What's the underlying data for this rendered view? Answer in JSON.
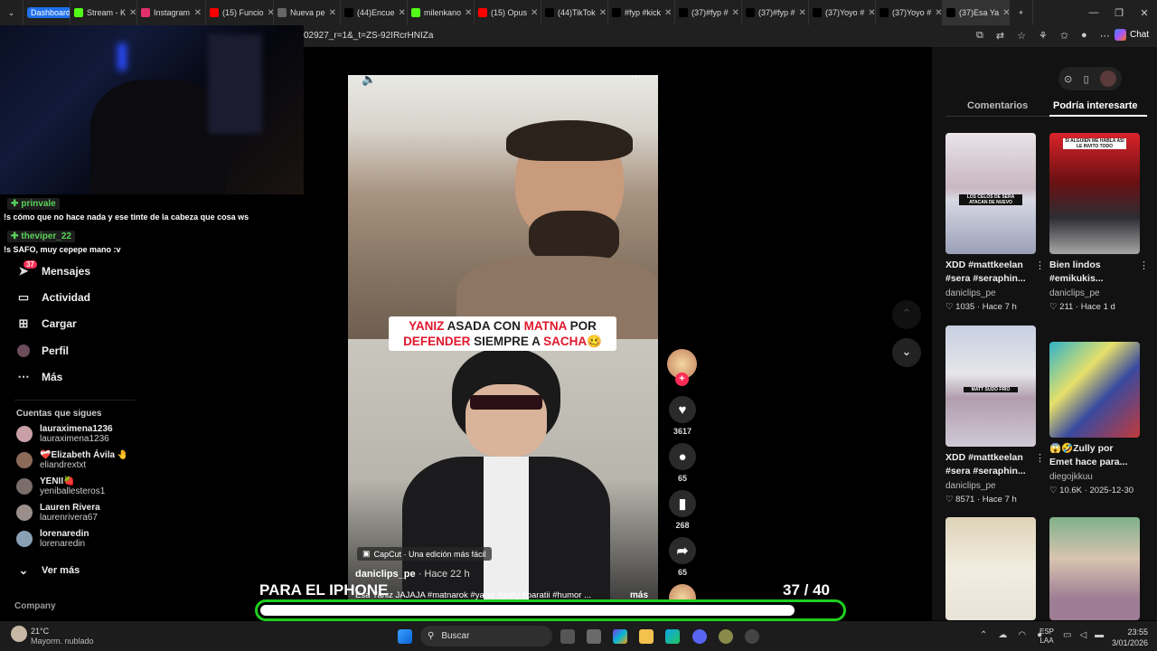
{
  "browser": {
    "tabs": [
      {
        "label": "Dashboard",
        "color": "#1f6feb"
      },
      {
        "label": "Stream - K",
        "color": "#53fc18"
      },
      {
        "label": "Instagram",
        "color": "#e1306c"
      },
      {
        "label": "(15) Funcio",
        "color": "#ff0000"
      },
      {
        "label": "Nueva pe",
        "color": "#666666"
      },
      {
        "label": "(44)Encue",
        "color": "#000000"
      },
      {
        "label": "milenkano",
        "color": "#53fc18"
      },
      {
        "label": "(15) Opus",
        "color": "#ff0000"
      },
      {
        "label": "(44)TikTok",
        "color": "#000000"
      },
      {
        "label": "#fyp #kick",
        "color": "#000000"
      },
      {
        "label": "(37)#fyp #",
        "color": "#000000"
      },
      {
        "label": "(37)#fyp #",
        "color": "#000000"
      },
      {
        "label": "(37)Yoyo #",
        "color": "#000000"
      },
      {
        "label": "(37)Yoyo #",
        "color": "#000000"
      },
      {
        "label": "(37)Esa Ya",
        "color": "#000000"
      }
    ],
    "url": "02927_r=1&_t=ZS-92IRcrHNIZa",
    "chat_label": "Chat"
  },
  "chat_overlay": [
    {
      "user": "prinvale",
      "msg": "!s cómo que no hace nada y ese tinte de la cabeza que cosa ws"
    },
    {
      "user": "theviper_22",
      "msg": "!s SAFO, muy cepepe mano :v"
    }
  ],
  "sidebar": {
    "nav": [
      {
        "label": "Mensajes",
        "icon": "send-icon",
        "badge": "37"
      },
      {
        "label": "Actividad",
        "icon": "inbox-icon"
      },
      {
        "label": "Cargar",
        "icon": "plus-box-icon"
      },
      {
        "label": "Perfil",
        "icon": "avatar-icon"
      },
      {
        "label": "Más",
        "icon": "more-icon"
      }
    ],
    "following_title": "Cuentas que sigues",
    "following": [
      {
        "name": "lauraximena1236",
        "handle": "lauraximena1236"
      },
      {
        "name": "❤️‍🩹Elizabeth Ávila 🤚",
        "handle": "eliandrextxt"
      },
      {
        "name": "YENII🍓",
        "handle": "yeniballesteros1"
      },
      {
        "name": "Lauren Rivera",
        "handle": "laurenrivera67"
      },
      {
        "name": "lorenaredin",
        "handle": "lorenaredin"
      }
    ],
    "see_more": "Ver más",
    "company": "Company"
  },
  "video": {
    "caption_line1_a": "YANIZ ",
    "caption_line1_b": "ASADA CON ",
    "caption_line1_c": "MATNA ",
    "caption_line1_d": "POR",
    "caption_line2_a": "DEFENDER ",
    "caption_line2_b": "SIEMPRE A ",
    "caption_line2_c": "SACHA",
    "caption_emoji": "🥴",
    "capcut": "CapCut · Una edición más fácil",
    "author": "daniclips_pe",
    "time": " · Hace 22 h",
    "description": "Esa Yaniz JAJAJA #matnarok #yaniz #zully #paratii #humor ...",
    "more": "más"
  },
  "actions": {
    "likes": "3617",
    "comments": "65",
    "saves": "268",
    "shares": "65"
  },
  "right_panel": {
    "tabs": [
      "Comentarios",
      "Podría interesarte"
    ],
    "cards": [
      {
        "title": "XDD #mattkeelan #sera #seraphin...",
        "author": "daniclips_pe",
        "likes": "1035",
        "time": "Hace 7 h"
      },
      {
        "title": "Bien lindos #emikukis...",
        "author": "daniclips_pe",
        "likes": "211",
        "time": "Hace 1 d"
      },
      {
        "title": "XDD #mattkeelan #sera #seraphin...",
        "author": "daniclips_pe",
        "likes": "8571",
        "time": "Hace 7 h"
      },
      {
        "title": "😱🤣Zully por Emet hace para...",
        "author": "diegojkkuu",
        "likes": "10.6K",
        "time": "2025-12-30"
      }
    ],
    "thumb_texts": [
      "LOS CELOS DE SERA ATACAN DE NUEVO",
      "SI ALGUIEN ME HABLA ASI LE INVITO TODO",
      "MATT SUDÓ FRÍO"
    ]
  },
  "overlay": {
    "bottom_text": "PARA EL IPHONE",
    "counter": "37   / 40",
    "progress": 0.92
  },
  "taskbar": {
    "temp": "21°C",
    "weather": "Mayorm. nublado",
    "search": "Buscar",
    "lang1": "ESP",
    "lang2": "LAA",
    "time": "23:55",
    "date": "3/01/2026"
  }
}
